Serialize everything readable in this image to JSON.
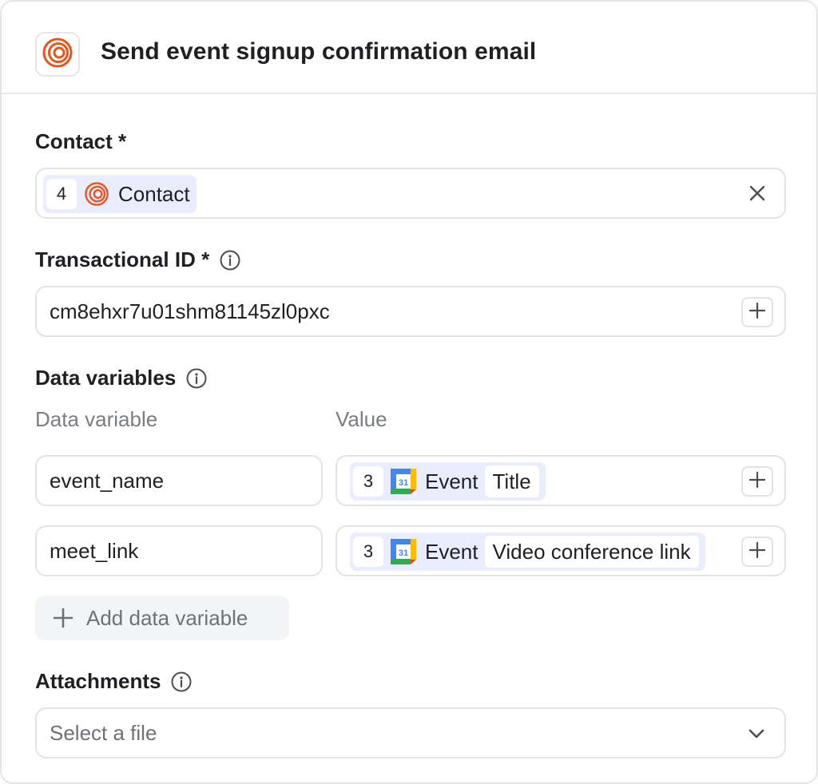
{
  "header": {
    "title": "Send event signup confirmation email",
    "app_icon": "loops-logo-icon"
  },
  "contact": {
    "label": "Contact *",
    "pill": {
      "step": "4",
      "icon": "loops-logo-icon",
      "text": "Contact"
    },
    "clear_icon": "close-icon"
  },
  "transactional_id": {
    "label": "Transactional ID *",
    "value": "cm8ehxr7u01shm81145zl0pxc",
    "info_icon": "info-icon"
  },
  "data_variables": {
    "label": "Data variables",
    "col_variable": "Data variable",
    "col_value": "Value",
    "rows": [
      {
        "name": "event_name",
        "step": "3",
        "icon": "google-calendar-icon",
        "source": "Event",
        "field": "Title"
      },
      {
        "name": "meet_link",
        "step": "3",
        "icon": "google-calendar-icon",
        "source": "Event",
        "field": "Video conference link"
      }
    ],
    "add_label": "Add data variable"
  },
  "attachments": {
    "label": "Attachments",
    "placeholder": "Select a file"
  },
  "colors": {
    "loops_orange": "#e8561e",
    "pill_bg": "#e9edff",
    "border": "#e1e3e6"
  }
}
